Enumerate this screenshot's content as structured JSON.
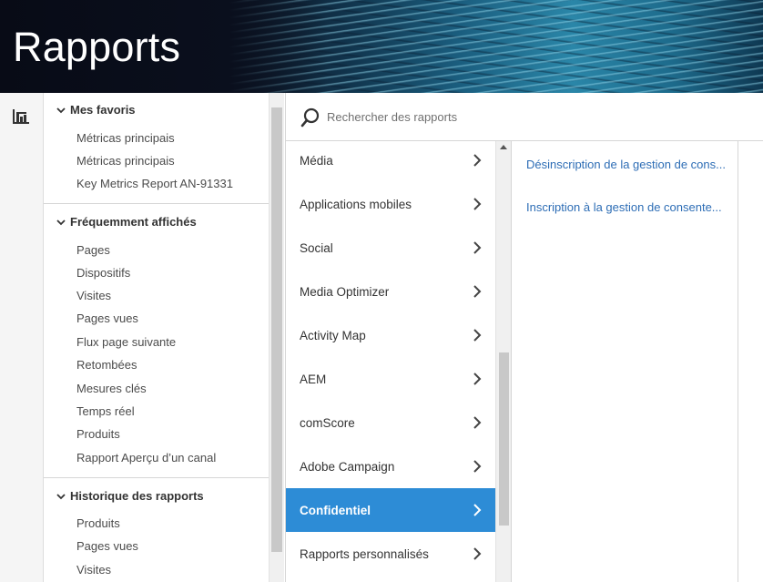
{
  "header": {
    "title": "Rapports"
  },
  "favorites": {
    "sections": [
      {
        "title": "Mes favoris",
        "items": [
          "Métricas principais",
          "Métricas principais",
          "Key Metrics Report AN-91331"
        ]
      },
      {
        "title": "Fréquemment affichés",
        "items": [
          "Pages",
          "Dispositifs",
          "Visites",
          "Pages vues",
          "Flux page suivante",
          "Retombées",
          "Mesures clés",
          "Temps réel",
          "Produits",
          "Rapport Aperçu d’un canal"
        ]
      },
      {
        "title": "Historique des rapports",
        "items": [
          "Produits",
          "Pages vues",
          "Visites"
        ]
      }
    ]
  },
  "search": {
    "placeholder": "Rechercher des rapports"
  },
  "categories": [
    {
      "label": "Média"
    },
    {
      "label": "Applications mobiles"
    },
    {
      "label": "Social"
    },
    {
      "label": "Media Optimizer"
    },
    {
      "label": "Activity Map"
    },
    {
      "label": "AEM"
    },
    {
      "label": "comScore"
    },
    {
      "label": "Adobe Campaign"
    },
    {
      "label": "Confidentiel",
      "active": true
    },
    {
      "label": "Rapports personnalisés"
    }
  ],
  "reports": [
    "Désinscription de la gestion de cons...",
    "Inscription à la gestion de consente..."
  ],
  "colors": {
    "accent": "#2d8cd6",
    "link": "#2d6db5"
  }
}
